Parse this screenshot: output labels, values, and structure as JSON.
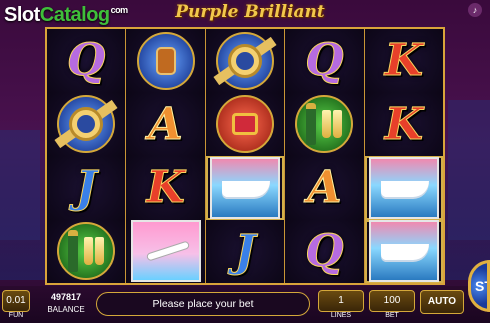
{
  "header": {
    "logo_main": "Slot",
    "logo_accent": "Catalog",
    "logo_suffix": "com",
    "title": "Purple Brilliant",
    "speaker_icon": "speaker-icon"
  },
  "reels": [
    [
      {
        "type": "letter",
        "value": "Q",
        "cls": "sym-q"
      },
      {
        "type": "watch"
      },
      {
        "type": "letter",
        "value": "J",
        "cls": "sym-j"
      },
      {
        "type": "champagne"
      }
    ],
    [
      {
        "type": "cognac"
      },
      {
        "type": "letter",
        "value": "A",
        "cls": "sym-a"
      },
      {
        "type": "letter",
        "value": "K",
        "cls": "sym-k"
      },
      {
        "type": "plane"
      }
    ],
    [
      {
        "type": "watch"
      },
      {
        "type": "ring"
      },
      {
        "type": "yacht",
        "win": true
      },
      {
        "type": "letter",
        "value": "J",
        "cls": "sym-j"
      }
    ],
    [
      {
        "type": "letter",
        "value": "Q",
        "cls": "sym-q"
      },
      {
        "type": "champagne"
      },
      {
        "type": "letter",
        "value": "A",
        "cls": "sym-a"
      },
      {
        "type": "letter",
        "value": "Q",
        "cls": "sym-q"
      }
    ],
    [
      {
        "type": "letter",
        "value": "K",
        "cls": "sym-k"
      },
      {
        "type": "letter",
        "value": "K",
        "cls": "sym-k"
      },
      {
        "type": "yacht",
        "win": true
      },
      {
        "type": "yacht",
        "win": true
      }
    ]
  ],
  "footer": {
    "fun_value": "0.01",
    "fun_label": "FUN",
    "balance_value": "497817",
    "balance_label": "BALANCE",
    "message": "Please place your bet",
    "lines_value": "1",
    "lines_label": "LINES",
    "bet_value": "100",
    "bet_label": "BET",
    "auto_label": "AUTO",
    "spin_label": "ST"
  }
}
